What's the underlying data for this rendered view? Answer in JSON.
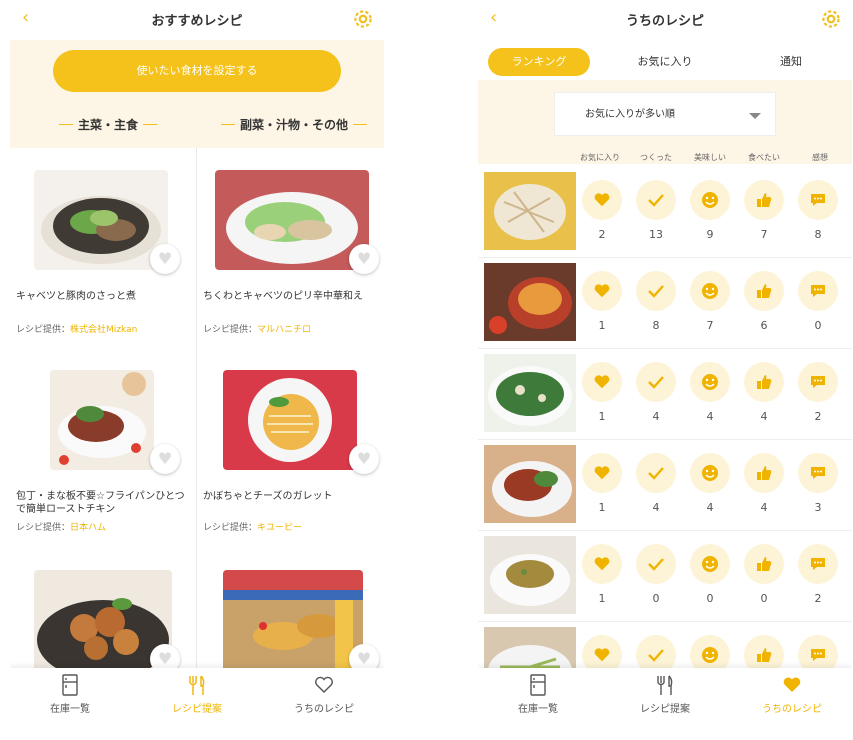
{
  "left": {
    "header": {
      "title": "おすすめレシピ",
      "back_icon": "chevron-left-icon",
      "settings_icon": "gear-icon"
    },
    "set_ingredients_button": "使いたい食材を設定する",
    "sections": {
      "main": "主菜・主食",
      "side": "副菜・汁物・その他"
    },
    "cards": [
      {
        "name": "キャベツと豚肉のさっと煮",
        "provider_label": "レシピ提供：",
        "provider": "株式会社Mizkan"
      },
      {
        "name": "ちくわとキャベツのピリ辛中華和え",
        "provider_label": "レシピ提供：",
        "provider": "マルハニチロ"
      },
      {
        "name": "包丁・まな板不要☆フライパンひとつで簡単ローストチキン",
        "provider_label": "レシピ提供：",
        "provider": "日本ハム"
      },
      {
        "name": "かぼちゃとチーズのガレット",
        "provider_label": "レシピ提供：",
        "provider": "キユーピー"
      },
      {
        "name": "",
        "provider_label": "",
        "provider": ""
      },
      {
        "name": "",
        "provider_label": "",
        "provider": ""
      }
    ],
    "tabbar": [
      {
        "label": "在庫一覧",
        "icon": "fridge-icon"
      },
      {
        "label": "レシピ提案",
        "icon": "fork-knife-icon"
      },
      {
        "label": "うちのレシピ",
        "icon": "heart-outline-icon"
      }
    ],
    "active_tab": 1
  },
  "right": {
    "header": {
      "title": "うちのレシピ",
      "back_icon": "chevron-left-icon",
      "settings_icon": "gear-icon"
    },
    "segments": [
      "ランキング",
      "お気に入り",
      "通知"
    ],
    "active_segment": 0,
    "sort_select": "お気に入りが多い順",
    "columns": [
      "お気に入り",
      "つくった",
      "美味しい",
      "食べたい",
      "感想"
    ],
    "column_icons": [
      "heart-icon",
      "check-icon",
      "smile-icon",
      "thumbs-up-icon",
      "comment-icon"
    ],
    "rows": [
      {
        "counts": [
          "2",
          "13",
          "9",
          "7",
          "8"
        ]
      },
      {
        "counts": [
          "1",
          "8",
          "7",
          "6",
          "0"
        ]
      },
      {
        "counts": [
          "1",
          "4",
          "4",
          "4",
          "2"
        ]
      },
      {
        "counts": [
          "1",
          "4",
          "4",
          "4",
          "3"
        ]
      },
      {
        "counts": [
          "1",
          "0",
          "0",
          "0",
          "2"
        ]
      },
      {
        "counts": [
          "",
          "",
          "",
          "",
          ""
        ]
      }
    ],
    "tabbar": [
      {
        "label": "在庫一覧",
        "icon": "fridge-icon"
      },
      {
        "label": "レシピ提案",
        "icon": "fork-knife-icon"
      },
      {
        "label": "うちのレシピ",
        "icon": "heart-filled-icon"
      }
    ],
    "active_tab": 2
  },
  "colors": {
    "accent": "#f4c21a",
    "accent_text": "#f0b400",
    "cream": "#fdf6e6",
    "icon_bg": "#fdf3d6"
  }
}
